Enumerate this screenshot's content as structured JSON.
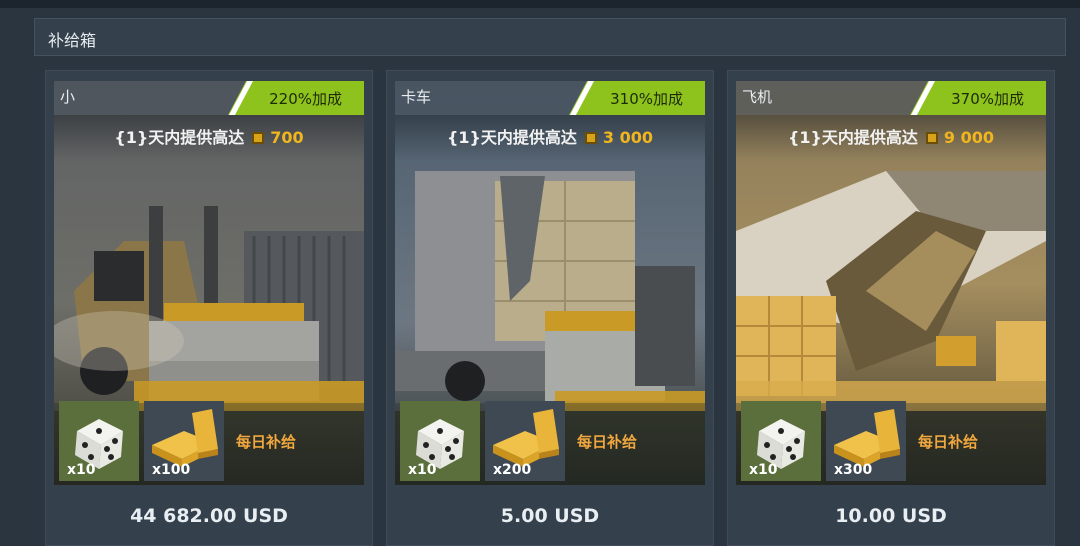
{
  "section": {
    "title": "补给箱"
  },
  "cards": [
    {
      "name": "小",
      "bonus": "220%加成",
      "offer_text": "{1}天内提供高达",
      "offer_amount": "700",
      "slot1_count": "x10",
      "slot2_count": "x100",
      "daily": "每日补给",
      "price": "44 682.00 USD"
    },
    {
      "name": "卡车",
      "bonus": "310%加成",
      "offer_text": "{1}天内提供高达",
      "offer_amount": "3 000",
      "slot1_count": "x10",
      "slot2_count": "x200",
      "daily": "每日补给",
      "price": "5.00 USD"
    },
    {
      "name": "飞机",
      "bonus": "370%加成",
      "offer_text": "{1}天内提供高达",
      "offer_amount": "9 000",
      "slot1_count": "x10",
      "slot2_count": "x300",
      "daily": "每日补给",
      "price": "10.00 USD"
    }
  ],
  "icons": {
    "currency": "gold-coin-icon",
    "slot1": "dice-icon",
    "slot2": "gold-bars-icon"
  },
  "colors": {
    "bonus_badge": "#8ec31d",
    "gold_amount": "#f1b51e",
    "daily_label": "#f0a73e",
    "dice_slot": "#5a6f3b"
  }
}
